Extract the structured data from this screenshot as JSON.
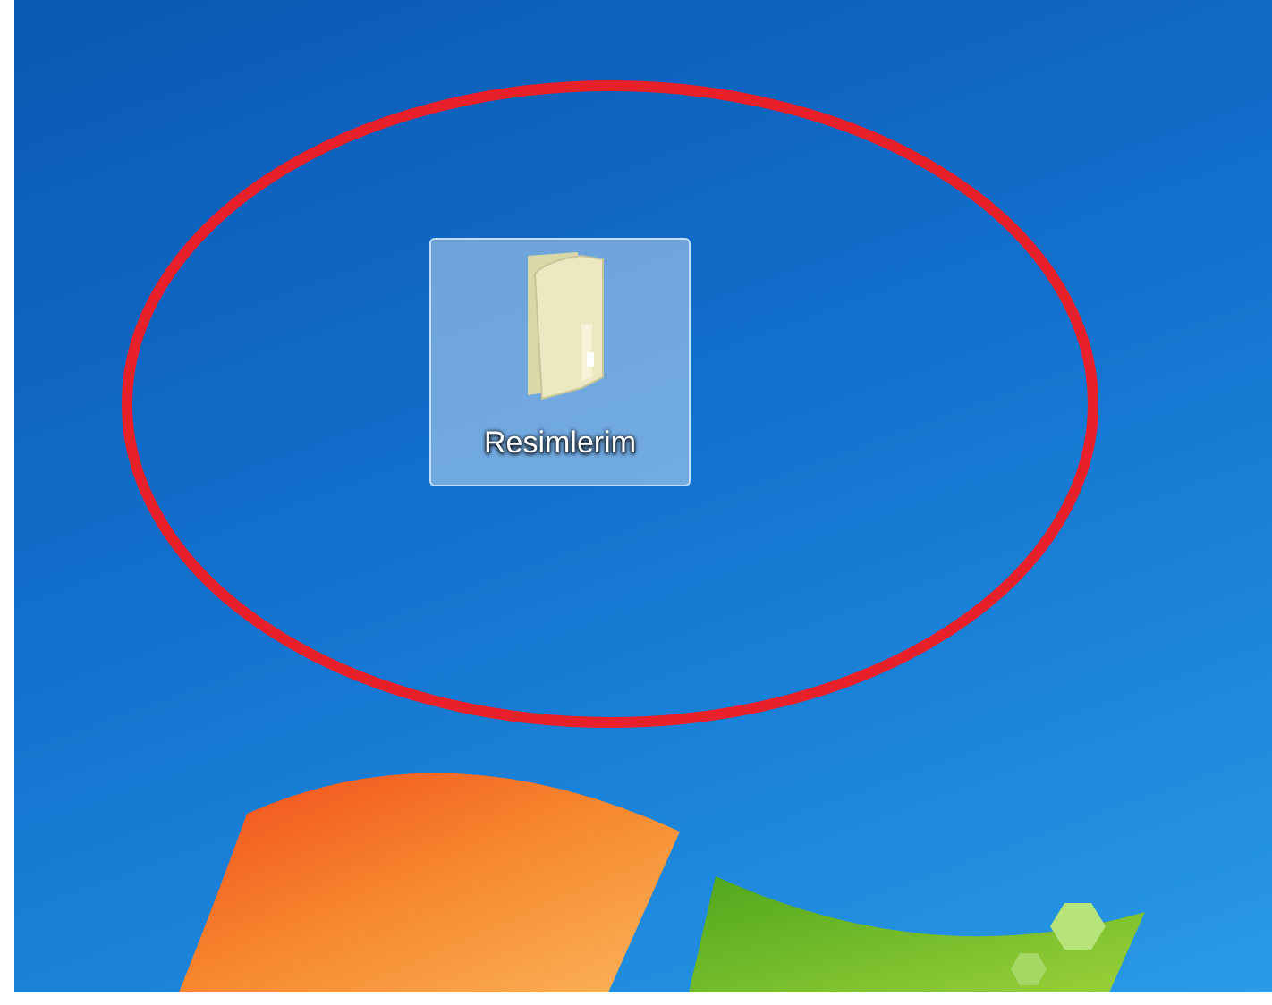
{
  "desktop": {
    "icons": [
      {
        "label": "Resimlerim",
        "selected": true
      }
    ]
  }
}
